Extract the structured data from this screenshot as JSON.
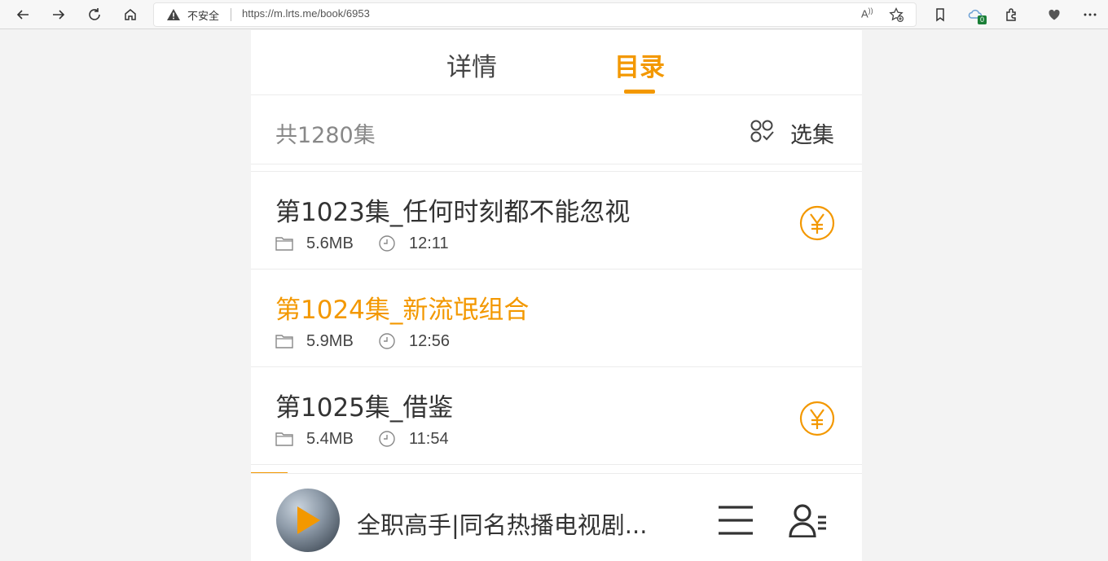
{
  "browser": {
    "security_label": "不安全",
    "url": "https://m.lrts.me/book/6953",
    "read_aloud_label": "A",
    "collections_badge": "0",
    "icons": [
      "back-icon",
      "forward-icon",
      "refresh-icon",
      "home-icon",
      "warning-icon",
      "read-aloud-icon",
      "add-favorite-icon",
      "favorites-icon",
      "sync-cloud-icon",
      "extensions-icon",
      "heart-icon",
      "more-icon"
    ]
  },
  "tabs": {
    "detail": "详情",
    "catalog": "目录"
  },
  "summary": {
    "count": "共1280集",
    "select_label": "选集"
  },
  "episodes": [
    {
      "title": "第1023集_任何时刻都不能忽视",
      "size": "5.6MB",
      "duration": "12:11",
      "paid": true
    },
    {
      "title": "第1024集_新流氓组合",
      "size": "5.9MB",
      "duration": "12:56",
      "paid": false
    },
    {
      "title": "第1025集_借鉴",
      "size": "5.4MB",
      "duration": "11:54",
      "paid": true
    }
  ],
  "player": {
    "title": "全职高手|同名热播电视剧...",
    "progress_fraction": 0.06
  },
  "colors": {
    "accent": "#f39800",
    "text": "#333333",
    "muted": "#888888"
  }
}
